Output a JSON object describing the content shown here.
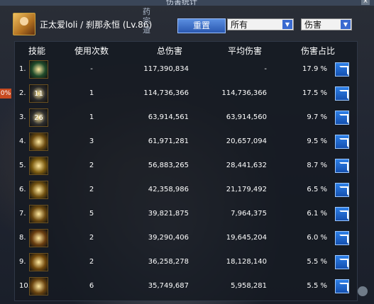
{
  "window": {
    "title": "伤害统计"
  },
  "character": {
    "name": "正太爱loli / 刹那永恒 (Lv.86)"
  },
  "side_text": "药宗道",
  "toolbar": {
    "reset_label": "重置",
    "filter_value": "所有",
    "type_value": "伤害"
  },
  "left_badge": "0%",
  "columns": [
    "技能",
    "使用次数",
    "总伤害",
    "平均伤害",
    "伤害占比"
  ],
  "rows": [
    {
      "rank": "1.",
      "icon": "",
      "uses": "-",
      "total": "117,390,834",
      "avg": "-",
      "pct": "17.9 %"
    },
    {
      "rank": "2.",
      "icon": "11",
      "uses": "1",
      "total": "114,736,366",
      "avg": "114,736,366",
      "pct": "17.5 %"
    },
    {
      "rank": "3.",
      "icon": "26",
      "uses": "1",
      "total": "63,914,561",
      "avg": "63,914,560",
      "pct": "9.7 %"
    },
    {
      "rank": "4.",
      "icon": "",
      "uses": "3",
      "total": "61,971,281",
      "avg": "20,657,094",
      "pct": "9.5 %"
    },
    {
      "rank": "5.",
      "icon": "",
      "uses": "2",
      "total": "56,883,265",
      "avg": "28,441,632",
      "pct": "8.7 %"
    },
    {
      "rank": "6.",
      "icon": "",
      "uses": "2",
      "total": "42,358,986",
      "avg": "21,179,492",
      "pct": "6.5 %"
    },
    {
      "rank": "7.",
      "icon": "",
      "uses": "5",
      "total": "39,821,875",
      "avg": "7,964,375",
      "pct": "6.1 %"
    },
    {
      "rank": "8.",
      "icon": "",
      "uses": "2",
      "total": "39,290,406",
      "avg": "19,645,204",
      "pct": "6.0 %"
    },
    {
      "rank": "9.",
      "icon": "",
      "uses": "2",
      "total": "36,258,278",
      "avg": "18,128,140",
      "pct": "5.5 %"
    },
    {
      "rank": "10.",
      "icon": "",
      "uses": "6",
      "total": "35,749,687",
      "avg": "5,958,281",
      "pct": "5.5 %"
    }
  ],
  "icon_colors": [
    "#1e4a2a",
    "#2a2a2a",
    "#2e2e2e",
    "#6a4a10",
    "#7a5a10",
    "#705010",
    "#6a4810",
    "#6a3e10",
    "#70480c",
    "#6a4410"
  ],
  "accent": "#2e80e8"
}
